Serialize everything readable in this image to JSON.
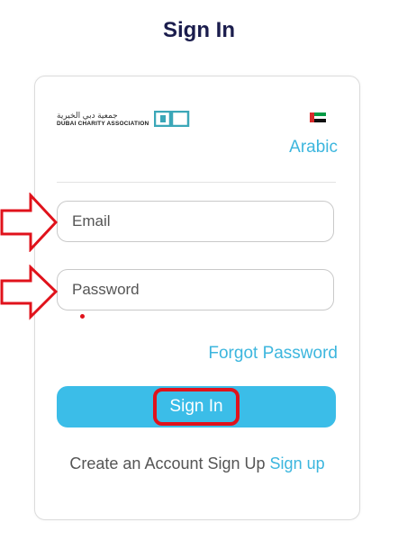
{
  "page": {
    "title": "Sign In"
  },
  "logo": {
    "arabic_text": "جمعية دبي الخيرية",
    "english_text": "DUBAI CHARITY ASSOCIATION",
    "mark_color": "#3ba7b8"
  },
  "language": {
    "link_label": "Arabic",
    "flag_icon": "uae-flag-icon"
  },
  "form": {
    "email_placeholder": "Email",
    "password_placeholder": "Password",
    "forgot_label": "Forgot Password",
    "submit_label": "Sign In"
  },
  "footer": {
    "prompt_text": "Create an Account Sign Up",
    "signup_label": "Sign up"
  },
  "colors": {
    "accent": "#3cb6de",
    "button_bg": "#3bbde8",
    "title": "#1b1d4d",
    "annotation_red": "#e0121b"
  },
  "annotations": {
    "email_arrow_icon": "right-arrow-icon",
    "password_arrow_icon": "right-arrow-icon"
  }
}
